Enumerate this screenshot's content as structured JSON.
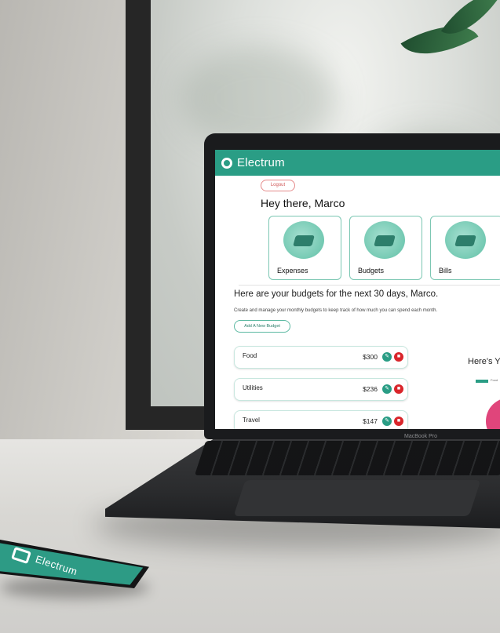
{
  "app": {
    "brand": "Electrum",
    "logout_label": "Logout",
    "greeting": "Hey there, Marco",
    "tiles": [
      {
        "label": "Expenses",
        "icon": "wallet-illustration-icon"
      },
      {
        "label": "Budgets",
        "icon": "presentation-illustration-icon"
      },
      {
        "label": "Bills",
        "icon": "desk-illustration-icon"
      }
    ],
    "budgets_title": "Here are your budgets for the next 30 days, Marco.",
    "budgets_subtitle": "Create and manage your monthly budgets to keep track of how much you can spend each month.",
    "add_budget_label": "Add A New Budget",
    "budgets": [
      {
        "name": "Food",
        "amount": "$300"
      },
      {
        "name": "Utilities",
        "amount": "$236"
      },
      {
        "name": "Travel",
        "amount": "$147"
      }
    ],
    "side_heading": "Here's Y",
    "legend_text": "Food"
  },
  "device": {
    "laptop_label": "MacBook Pro",
    "phone_brand": "Electrum"
  },
  "colors": {
    "accent": "#2a9d85",
    "danger": "#d9262b",
    "pie": "#e0457b"
  }
}
